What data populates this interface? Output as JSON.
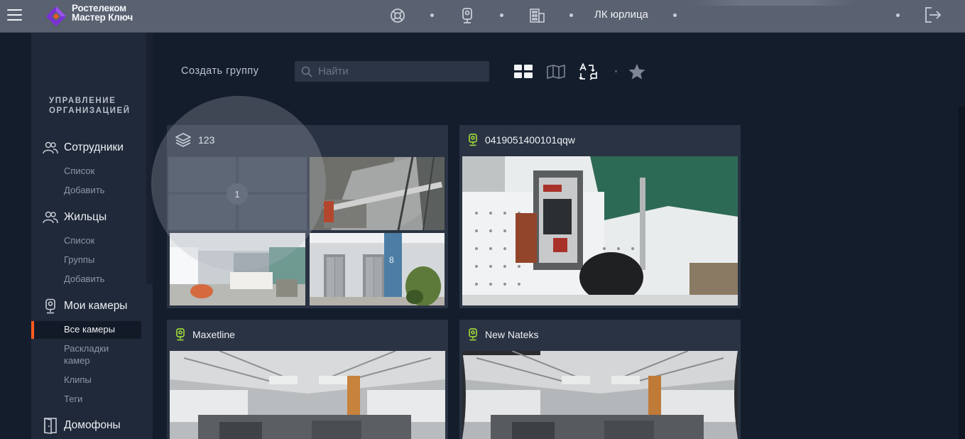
{
  "app": {
    "brand_line1": "Ростелеком",
    "brand_line2": "Мастер Ключ",
    "org_name": "ЛК юрлица"
  },
  "topbar": {
    "icons": [
      "support-icon",
      "intercom-icon",
      "building-icon"
    ],
    "logout_icon": "logout-icon"
  },
  "sidebar": {
    "section_title_line1": "УПРАВЛЕНИЕ",
    "section_title_line2": "ОРГАНИЗАЦИЕЙ",
    "groups": [
      {
        "label": "Сотрудники",
        "icon": "users-icon",
        "items": [
          "Список",
          "Добавить"
        ]
      },
      {
        "label": "Жильцы",
        "icon": "users-icon",
        "items": [
          "Список",
          "Группы",
          "Добавить"
        ]
      },
      {
        "label": "Мои камеры",
        "icon": "camera-icon",
        "items": [
          "Все камеры",
          "Раскладки камер",
          "Клипы",
          "Теги"
        ]
      },
      {
        "label": "Домофоны",
        "icon": "door-icon",
        "items": []
      }
    ],
    "active_item": "Все камеры",
    "layouts_line1": "Раскладки",
    "layouts_line2": "камер"
  },
  "toolbar": {
    "create_group_label": "Создать группу",
    "search_placeholder": "Найти",
    "views": [
      "grid-view-icon",
      "map-view-icon",
      "sort-icon",
      "favorites-icon"
    ]
  },
  "cards": [
    {
      "title": "123",
      "type": "group",
      "count_badge": "1"
    },
    {
      "title": "0419051400101qqw",
      "type": "camera"
    },
    {
      "title": "Maxetline",
      "type": "camera"
    },
    {
      "title": "New Nateks",
      "type": "camera"
    }
  ],
  "colors": {
    "accent": "#ff5a1f",
    "camera_icon": "#9bd33b",
    "background": "#141d2c",
    "topbar": "#5a6170"
  }
}
